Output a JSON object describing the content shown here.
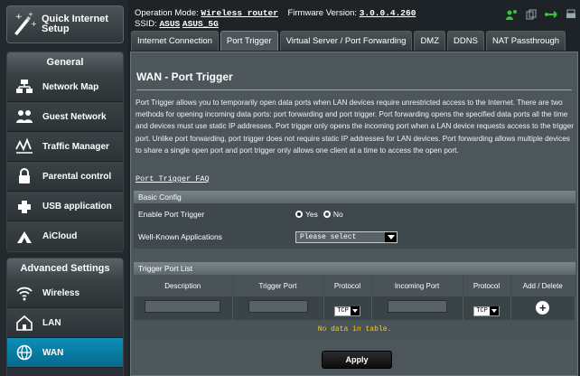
{
  "sidebar": {
    "qis_label": "Quick Internet Setup",
    "general": {
      "header": "General",
      "items": [
        {
          "label": "Network Map",
          "icon": "network-map-icon"
        },
        {
          "label": "Guest Network",
          "icon": "guest-network-icon"
        },
        {
          "label": "Traffic Manager",
          "icon": "traffic-manager-icon"
        },
        {
          "label": "Parental control",
          "icon": "parental-control-icon"
        },
        {
          "label": "USB application",
          "icon": "usb-application-icon"
        },
        {
          "label": "AiCloud",
          "icon": "aicloud-icon"
        }
      ]
    },
    "advanced": {
      "header": "Advanced Settings",
      "items": [
        {
          "label": "Wireless",
          "icon": "wireless-icon"
        },
        {
          "label": "LAN",
          "icon": "lan-icon"
        },
        {
          "label": "WAN",
          "icon": "wan-icon",
          "active": true
        }
      ]
    }
  },
  "header": {
    "op_mode_label": "Operation Mode:",
    "op_mode_value": "Wireless router",
    "firmware_label": "Firmware Version:",
    "firmware_value": "3.0.0.4.260",
    "ssid_label": "SSID:",
    "ssid_1": "ASUS",
    "ssid_2": "ASUS_5G"
  },
  "tabs": [
    {
      "label": "Internet Connection"
    },
    {
      "label": "Port Trigger",
      "active": true
    },
    {
      "label": "Virtual Server / Port Forwarding"
    },
    {
      "label": "DMZ"
    },
    {
      "label": "DDNS"
    },
    {
      "label": "NAT Passthrough"
    }
  ],
  "main": {
    "title": "WAN - Port Trigger",
    "description": "Port Trigger allows you to temporarily open data ports when LAN devices require unrestricted access to the Internet. There are two methods for opening incoming data ports: port forwarding and port trigger. Port forwarding opens the specified data ports all the time and devices must use static IP addresses. Port trigger only opens the incoming port when a LAN device requests access to the trigger port. Unlike port forwarding, port trigger does not require static IP addresses for LAN devices. Port forwarding allows multiple devices to share a single open port and port trigger only allows one client at a time to access the open port.",
    "faq_link": "Port Trigger FAQ",
    "basic_config": {
      "header": "Basic Config",
      "enable_label": "Enable Port Trigger",
      "yes_label": "Yes",
      "no_label": "No",
      "enabled": false,
      "wellknown_label": "Well-Known Applications",
      "wellknown_value": "Please select"
    },
    "trigger_list": {
      "header": "Trigger Port List",
      "columns": [
        "Description",
        "Trigger Port",
        "Protocol",
        "Incoming Port",
        "Protocol",
        "Add / Delete"
      ],
      "protocol_trigger": "TCP",
      "protocol_incoming": "TCP",
      "empty_text": "No data in table."
    },
    "apply_label": "Apply"
  },
  "colors": {
    "accent": "#0c8fb8",
    "status_green": "#35c43a",
    "empty_text": "#ffcc00"
  }
}
